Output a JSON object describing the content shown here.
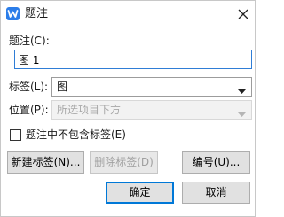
{
  "window": {
    "title": "题注",
    "app_icon": "wps-writer-icon",
    "accent": "#2b7de9"
  },
  "caption": {
    "label": "题注(C):",
    "value": "图 1"
  },
  "label_field": {
    "label": "标签(L):",
    "value": "图"
  },
  "position_field": {
    "label": "位置(P):",
    "value": "所选项目下方",
    "disabled": true
  },
  "exclude_label": {
    "label": "题注中不包含标签(E)",
    "checked": false
  },
  "buttons": {
    "new_label": "新建标签(N)...",
    "delete_label": "删除标签(D)",
    "numbering": "编号(U)...",
    "ok": "确定",
    "cancel": "取消"
  }
}
